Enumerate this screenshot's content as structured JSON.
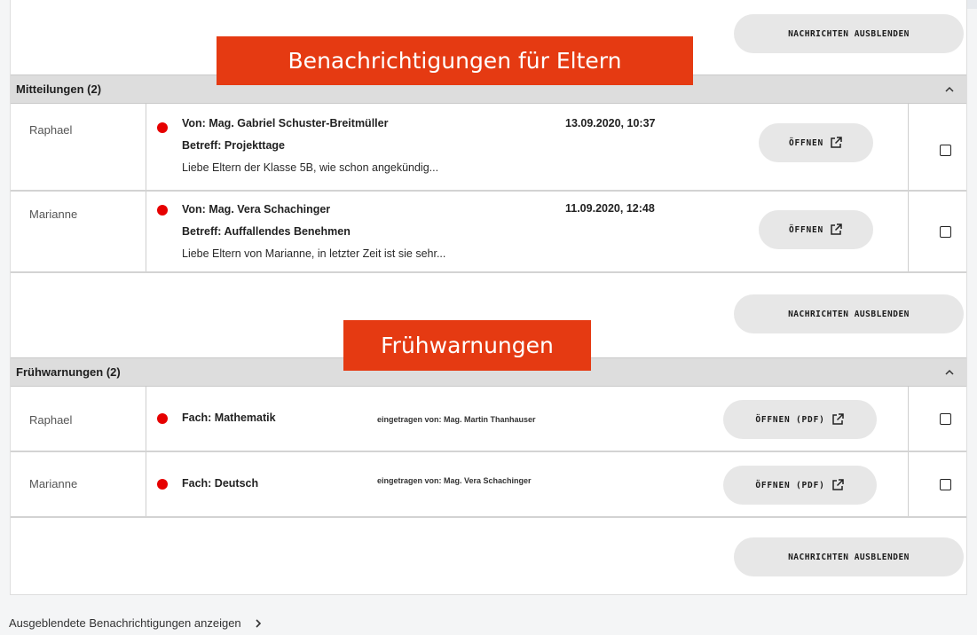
{
  "overlays": {
    "parents_banner": "Benachrichtigungen für Eltern",
    "warnings_banner": "Frühwarnungen"
  },
  "actions": {
    "hide_messages_label": "NACHRICHTEN AUSBLENDEN"
  },
  "messages_section": {
    "title": "Mitteilungen (2)",
    "open_label": "ÖFFNEN",
    "items": [
      {
        "student": "Raphael",
        "from": "Von: Mag. Gabriel Schuster-Breitmüller",
        "date": "13.09.2020, 10:37",
        "subject": "Betreff: Projekttage",
        "preview": "Liebe Eltern der Klasse 5B, wie schon angekündig..."
      },
      {
        "student": "Marianne",
        "from": "Von: Mag. Vera Schachinger",
        "date": "11.09.2020, 12:48",
        "subject": "Betreff: Auffallendes Benehmen",
        "preview": "Liebe Eltern von Marianne, in letzter Zeit ist sie sehr..."
      }
    ]
  },
  "warnings_section": {
    "title": "Frühwarnungen (2)",
    "open_label": "ÖFFNEN (PDF)",
    "items": [
      {
        "student": "Raphael",
        "subject": "Fach: Mathematik",
        "entered_by": "eingetragen von: Mag. Martin Thanhauser"
      },
      {
        "student": "Marianne",
        "subject": "Fach: Deutsch",
        "entered_by": "eingetragen von: Mag. Vera Schachinger"
      }
    ]
  },
  "footer": {
    "show_hidden_label": "Ausgeblendete Benachrichtigungen anzeigen"
  },
  "colors": {
    "unread_dot": "#e60000",
    "banner": "#e53a12"
  },
  "icons": {
    "collapse": "chevron-up-icon",
    "open_external": "external-link-icon",
    "footer_arrow": "chevron-right-icon"
  }
}
